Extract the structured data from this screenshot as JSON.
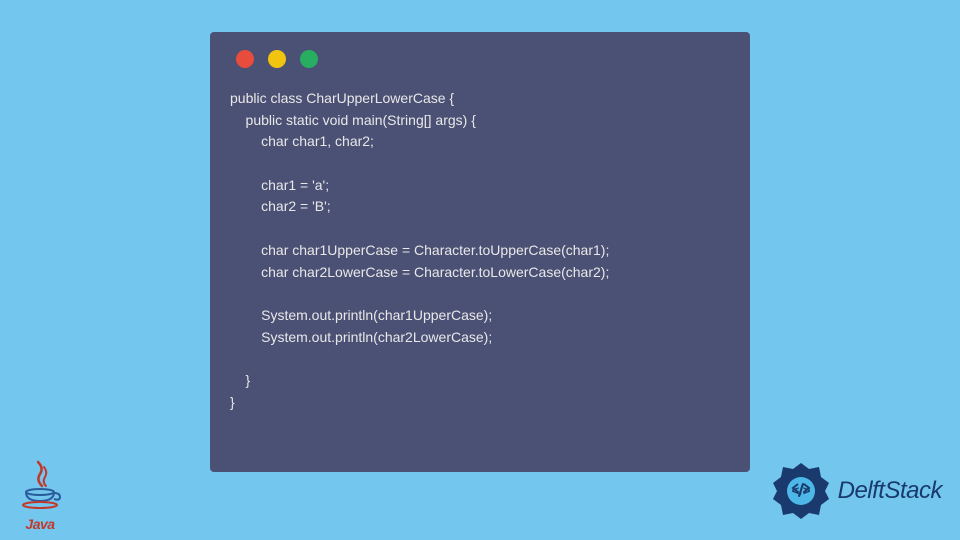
{
  "code": {
    "line1": "public class CharUpperLowerCase {",
    "line2": "    public static void main(String[] args) {",
    "line3": "        char char1, char2;",
    "line4": "",
    "line5": "        char1 = 'a';",
    "line6": "        char2 = 'B';",
    "line7": "",
    "line8": "        char char1UpperCase = Character.toUpperCase(char1);",
    "line9": "        char char2LowerCase = Character.toLowerCase(char2);",
    "line10": "",
    "line11": "        System.out.println(char1UpperCase);",
    "line12": "        System.out.println(char2LowerCase);",
    "line13": "",
    "line14": "    }",
    "line15": "}"
  },
  "logos": {
    "java_label": "Java",
    "delft_label": "DelftStack"
  }
}
